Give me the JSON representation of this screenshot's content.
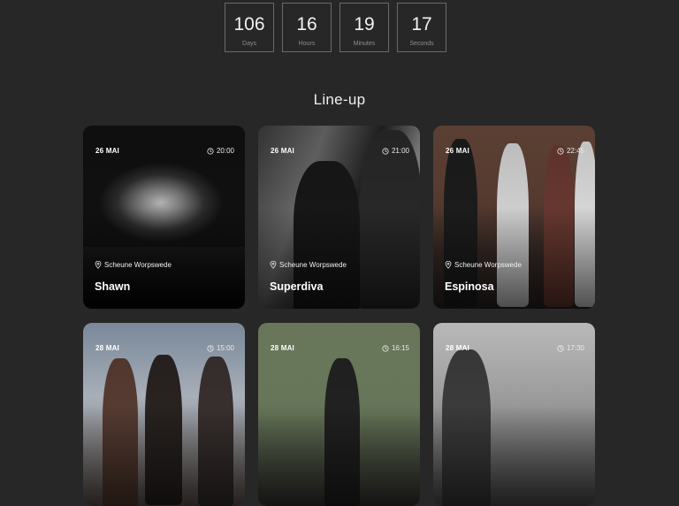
{
  "countdown": [
    {
      "value": "106",
      "label": "Days"
    },
    {
      "value": "16",
      "label": "Hours"
    },
    {
      "value": "19",
      "label": "Minutes"
    },
    {
      "value": "17",
      "label": "Seconds"
    }
  ],
  "section_title": "Line-up",
  "cards": [
    {
      "date": "26 MAI",
      "time": "20:00",
      "venue": "Scheune Worpswede",
      "name": "Shawn"
    },
    {
      "date": "26 MAI",
      "time": "21:00",
      "venue": "Scheune Worpswede",
      "name": "Superdiva"
    },
    {
      "date": "26 MAI",
      "time": "22:45",
      "venue": "Scheune Worpswede",
      "name": "Espinosa"
    },
    {
      "date": "28 MAI",
      "time": "15:00"
    },
    {
      "date": "28 MAI",
      "time": "16:15"
    },
    {
      "date": "28 MAI",
      "time": "17:30"
    }
  ],
  "icons": {
    "time": "clock-icon",
    "venue": "map-pin-icon"
  }
}
